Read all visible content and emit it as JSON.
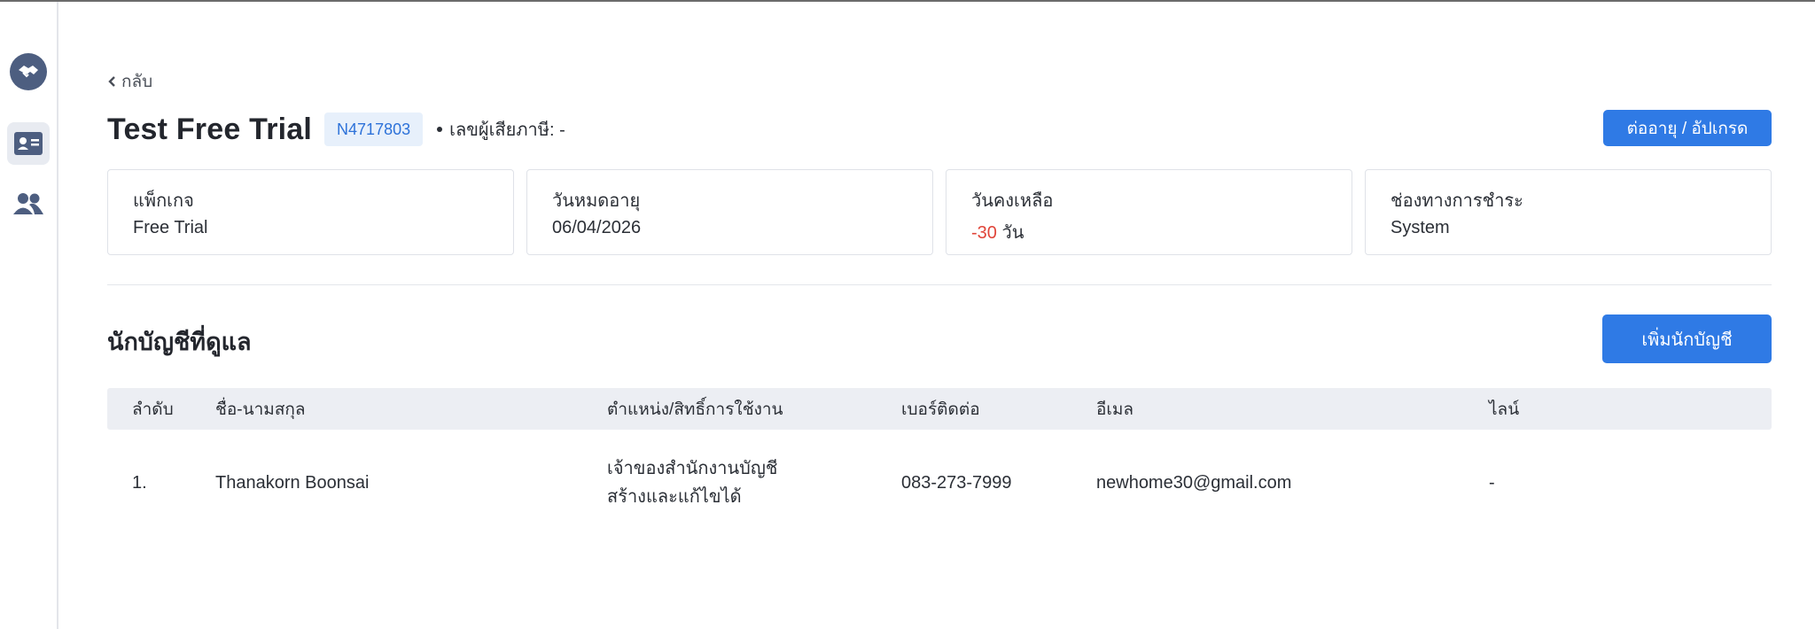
{
  "header": {
    "back_label": "กลับ",
    "title": "Test Free Trial",
    "code": "N4717803",
    "tax_label": "เลขผู้เสียภาษี: -",
    "renew_button": "ต่ออายุ / อัปเกรด"
  },
  "sidebar": {
    "items": [
      {
        "icon": "handshake-logo-icon"
      },
      {
        "icon": "contact-card-icon",
        "active": true
      },
      {
        "icon": "users-icon"
      }
    ]
  },
  "cards": [
    {
      "label": "แพ็กเกจ",
      "value": "Free Trial"
    },
    {
      "label": "วันหมดอายุ",
      "value": "06/04/2026"
    },
    {
      "label": "วันคงเหลือ",
      "value_number": "-30",
      "value_unit": "วัน"
    },
    {
      "label": "ช่องทางการชำระ",
      "value": "System"
    }
  ],
  "accountants": {
    "title": "นักบัญชีที่ดูแล",
    "add_button": "เพิ่มนักบัญชี",
    "columns": [
      "ลำดับ",
      "ชื่อ-นามสกุล",
      "ตำแหน่ง/สิทธิ์การใช้งาน",
      "เบอร์ติดต่อ",
      "อีเมล",
      "ไลน์"
    ],
    "rows": [
      {
        "index": "1.",
        "name": "Thanakorn Boonsai",
        "role_line1": "เจ้าของสำนักงานบัญชี",
        "role_line2": "สร้างและแก้ไขได้",
        "phone": "083-273-7999",
        "email": "newhome30@gmail.com",
        "line": "-"
      }
    ]
  },
  "colors": {
    "primary": "#2f7ae5",
    "badge_bg": "#e7f0fb",
    "negative": "#e0453a",
    "sidebar_icon": "#4d5e80"
  }
}
